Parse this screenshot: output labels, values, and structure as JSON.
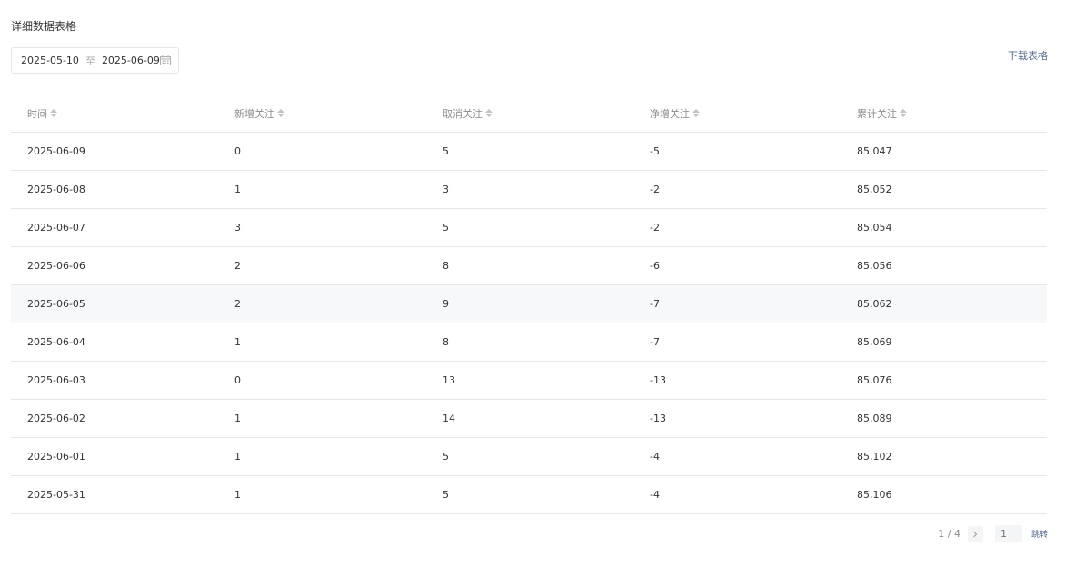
{
  "section": {
    "title": "详细数据表格"
  },
  "date_range": {
    "start": "2025-05-10",
    "separator": "至",
    "end": "2025-06-09",
    "icon": "calendar-icon"
  },
  "download": {
    "label": "下载表格"
  },
  "table": {
    "columns": [
      "时间",
      "新增关注",
      "取消关注",
      "净增关注",
      "累计关注"
    ],
    "rows": [
      [
        "2025-06-09",
        "0",
        "5",
        "-5",
        "85,047"
      ],
      [
        "2025-06-08",
        "1",
        "3",
        "-2",
        "85,052"
      ],
      [
        "2025-06-07",
        "3",
        "5",
        "-2",
        "85,054"
      ],
      [
        "2025-06-06",
        "2",
        "8",
        "-6",
        "85,056"
      ],
      [
        "2025-06-05",
        "2",
        "9",
        "-7",
        "85,062"
      ],
      [
        "2025-06-04",
        "1",
        "8",
        "-7",
        "85,069"
      ],
      [
        "2025-06-03",
        "0",
        "13",
        "-13",
        "85,076"
      ],
      [
        "2025-06-02",
        "1",
        "14",
        "-13",
        "85,089"
      ],
      [
        "2025-06-01",
        "1",
        "5",
        "-4",
        "85,102"
      ],
      [
        "2025-05-31",
        "1",
        "5",
        "-4",
        "85,106"
      ]
    ]
  },
  "pagination": {
    "page_info": "1 / 4",
    "input_placeholder": "1",
    "jump_label": "跳转",
    "next_icon": "chevron-right-icon"
  },
  "colors": {
    "link": "#576b95",
    "border": "#e7e7e7",
    "header_text": "#8c8c8c",
    "row_hover": "#f7f8fa"
  }
}
